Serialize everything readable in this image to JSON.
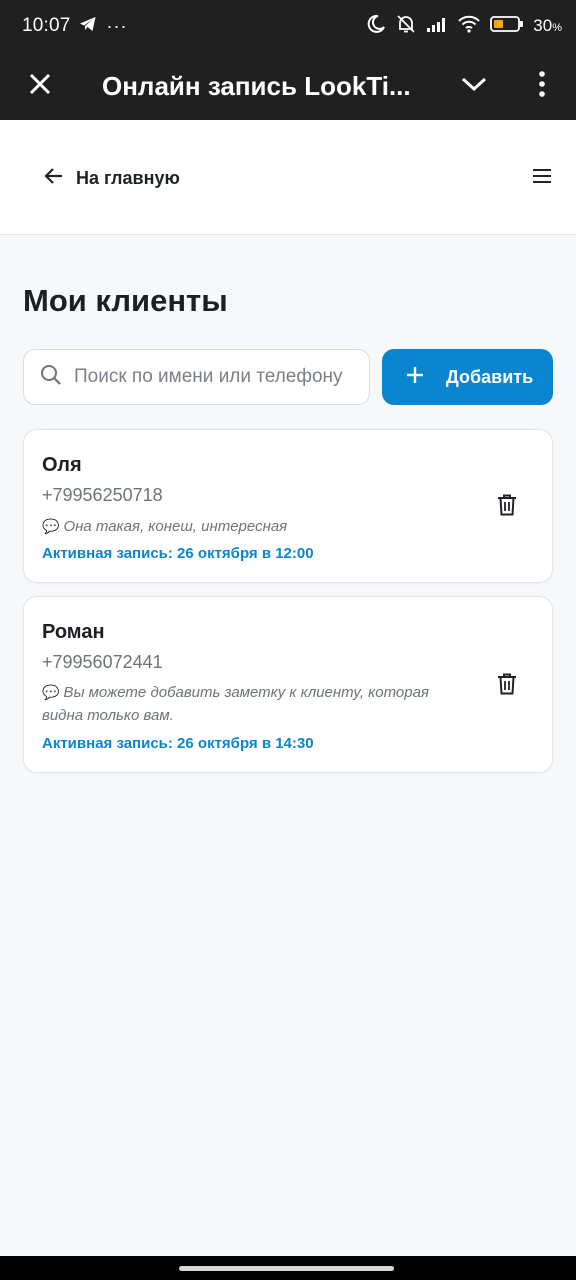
{
  "status_bar": {
    "time": "10:07",
    "more_dots": "···",
    "battery_percent": "30",
    "battery_unit": "%"
  },
  "app_bar": {
    "title": "Онлайн запись LookTi..."
  },
  "header": {
    "back_label": "На главную"
  },
  "page": {
    "title": "Мои клиенты"
  },
  "search": {
    "placeholder": "Поиск по имени или телефону",
    "value": ""
  },
  "add_button": {
    "label": "Добавить"
  },
  "clients": [
    {
      "name": "Оля",
      "phone": "+79956250718",
      "note": "Она такая, конеш, интересная",
      "booking": "Активная запись: 26 октября в 12:00"
    },
    {
      "name": "Роман",
      "phone": "+79956072441",
      "note": "Вы можете добавить заметку к клиенту, которая видна только вам.",
      "booking": "Активная запись: 26 октября в 14:30"
    }
  ],
  "colors": {
    "accent": "#0a86d0",
    "app_bar": "#202020",
    "background": "#f7f8fa"
  },
  "icons": {
    "note": "speech-bubble-icon",
    "delete": "trash-icon",
    "back": "arrow-left-icon",
    "menu": "hamburger-menu-icon"
  }
}
